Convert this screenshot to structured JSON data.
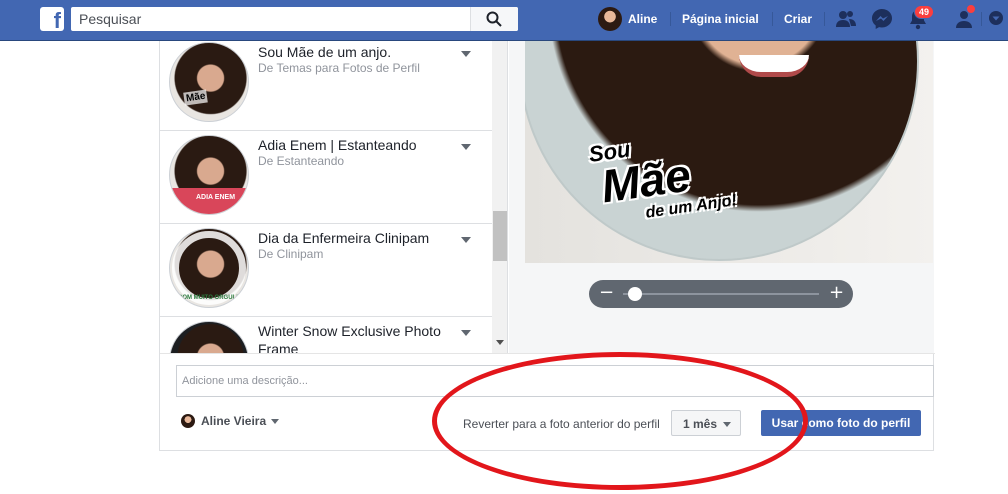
{
  "topbar": {
    "logo": "f",
    "search_placeholder": "Pesquisar",
    "profile_name": "Aline",
    "home": "Página inicial",
    "create": "Criar",
    "notifications_count": "49",
    "accent": "#4267b2"
  },
  "frames": [
    {
      "title": "Sou Mãe de um anjo.",
      "source": "De Temas para Fotos de Perfil",
      "thumb_text": "Mãe"
    },
    {
      "title": "Adia Enem | Estanteando",
      "source": "De Estanteando",
      "thumb_text": "ADIA ENEM"
    },
    {
      "title": "Dia da Enfermeira Clinipam",
      "source": "De Clinipam",
      "thumb_text": "COM MUITO ORGULHO"
    },
    {
      "title": "Winter Snow Exclusive Photo Frame",
      "source": "",
      "thumb_text": ""
    }
  ],
  "preview": {
    "overlay_line1": "Sou",
    "overlay_line2": "Mãe",
    "overlay_line3": "de um Anjo!",
    "zoom_minus": "−",
    "zoom_plus": "+",
    "zoom_level": 0.06
  },
  "description_placeholder": "Adicione uma descrição...",
  "footer": {
    "owner": "Aline Vieira",
    "revert_text": "Reverter para a foto anterior do perfil",
    "duration": "1 mês",
    "use_button": "Usar como foto do perfil"
  },
  "colors": {
    "annotation": "#e2161b",
    "primary_button": "#4267b2"
  }
}
